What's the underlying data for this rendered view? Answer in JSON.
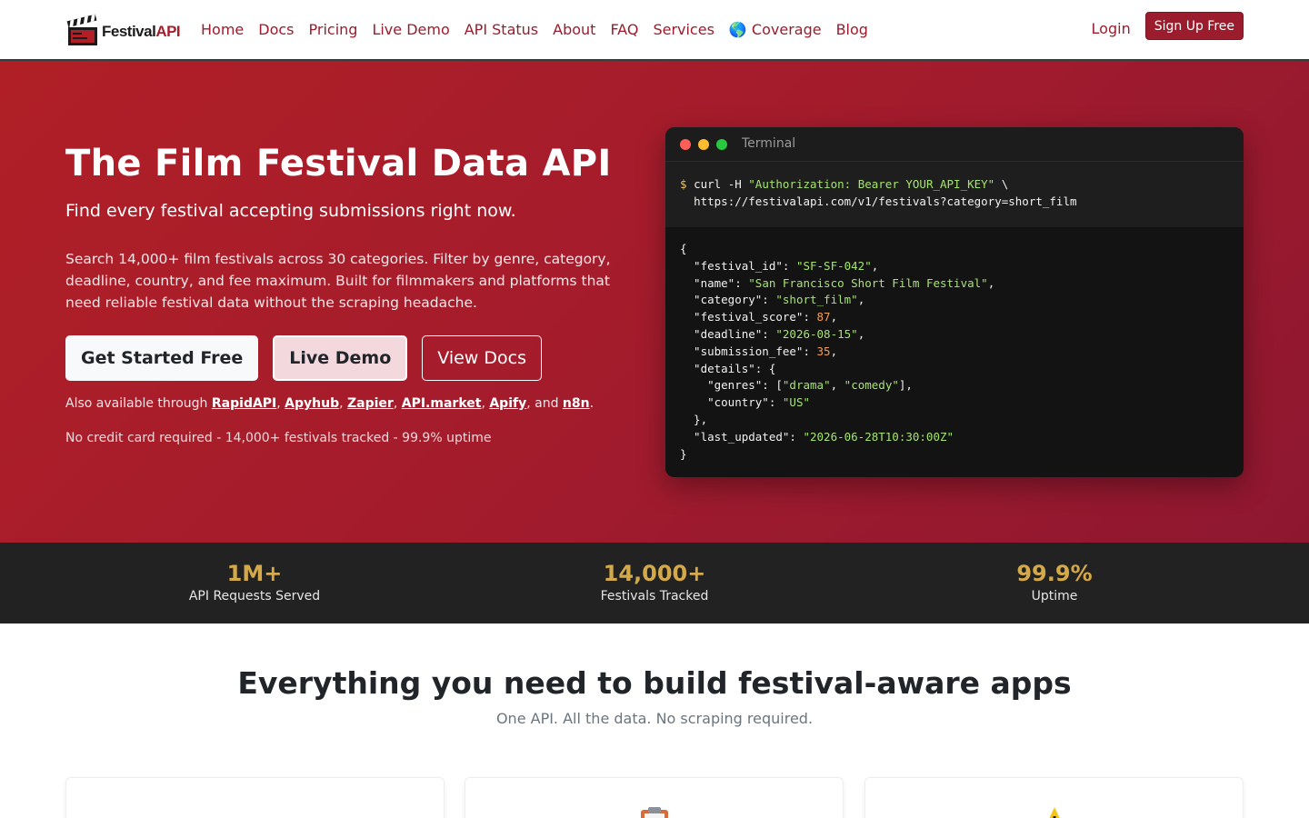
{
  "nav": {
    "brand_main": "Festival",
    "brand_accent": "API",
    "links": [
      "Home",
      "Docs",
      "Pricing",
      "Live Demo",
      "API Status",
      "About",
      "FAQ",
      "Services",
      "🌎 Coverage",
      "Blog"
    ],
    "login": "Login",
    "signup": "Sign Up Free"
  },
  "hero": {
    "title": "The Film Festival Data API",
    "subtitle": "Find every festival accepting submissions right now.",
    "description": "Search 14,000+ film festivals across 30 categories. Filter by genre, category, deadline, country, and fee maximum. Built for filmmakers and platforms that need reliable festival data without the scraping headache.",
    "buttons": {
      "primary": "Get Started Free",
      "demo": "Live Demo",
      "docs": "View Docs"
    },
    "also_prefix": "Also available through ",
    "platforms": [
      "RapidAPI",
      "Apyhub",
      "Zapier",
      "API.market",
      "Apify",
      "n8n"
    ],
    "also_and": "and",
    "note": "No credit card required - 14,000+ festivals tracked - 99.9% uptime"
  },
  "terminal": {
    "title": "Terminal",
    "prompt": "$",
    "cmd_part1": "curl -H ",
    "cmd_header": "\"Authorization: Bearer YOUR_API_KEY\"",
    "cmd_cont": " \\",
    "cmd_url": "https://festivalapi.com/v1/festivals?category=short_film",
    "response": {
      "festival_id": "SF-SF-042",
      "name": "San Francisco Short Film Festival",
      "category": "short_film",
      "festival_score": "87",
      "deadline": "2026-08-15",
      "submission_fee": "35",
      "genre_1": "drama",
      "genre_2": "comedy",
      "country": "US",
      "last_updated": "2026-06-28T10:30:00Z"
    }
  },
  "stats": [
    {
      "value": "1M+",
      "label": "API Requests Served"
    },
    {
      "value": "14,000+",
      "label": "Festivals Tracked"
    },
    {
      "value": "99.9%",
      "label": "Uptime"
    }
  ],
  "features": {
    "title": "Everything you need to build festival-aware apps",
    "subtitle": "One API. All the data. No scraping required.",
    "cards": [
      {
        "icon": "clapperboard-icon"
      },
      {
        "icon": "clipboard-icon"
      },
      {
        "icon": "warning-icon"
      }
    ]
  },
  "colors": {
    "brand": "#9b1c2c",
    "hero_start": "#b01f26",
    "hero_end": "#8e1730",
    "stat_gold": "#d4a94a"
  }
}
